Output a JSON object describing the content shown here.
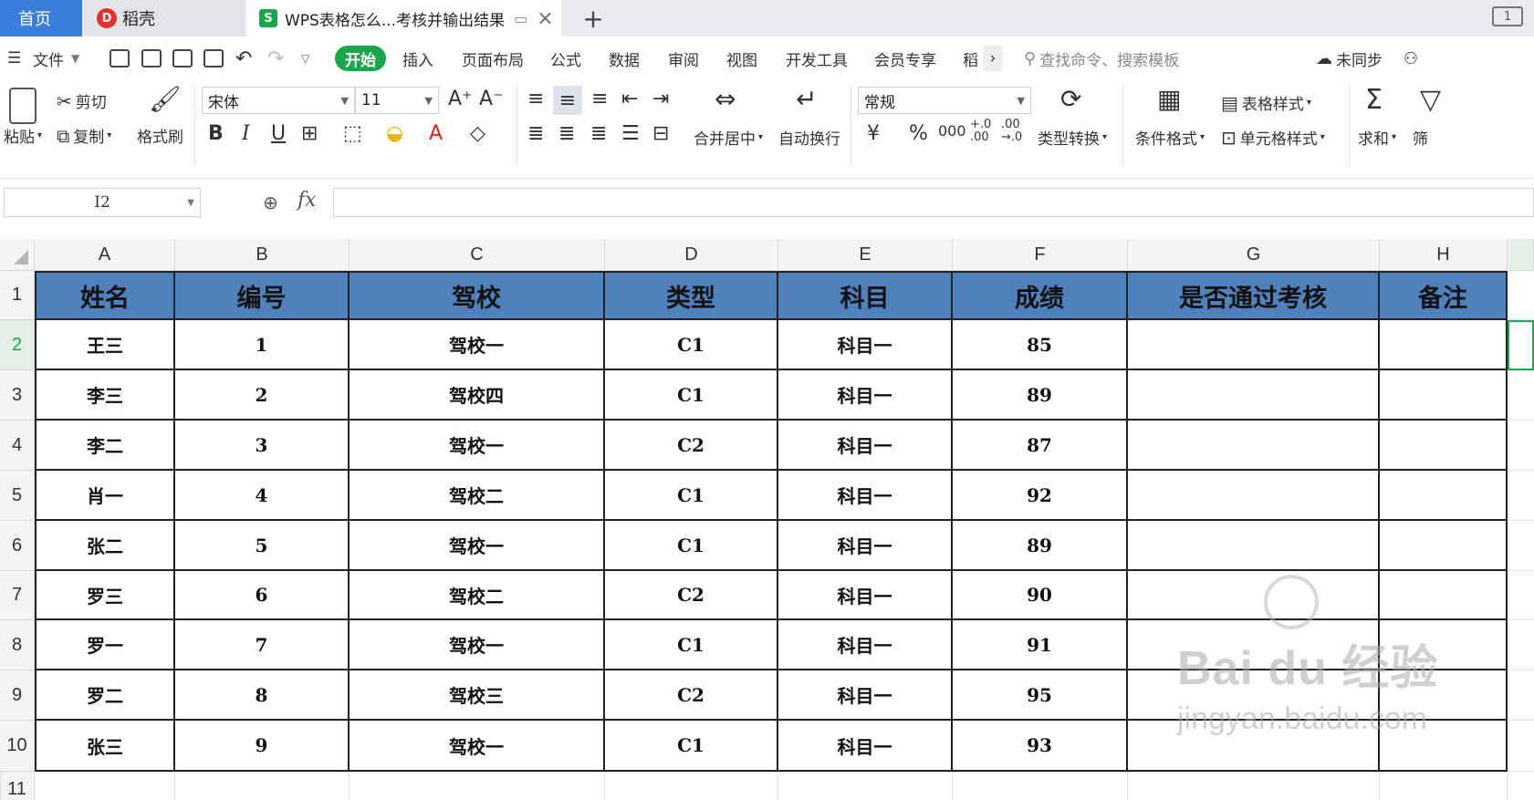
{
  "tabs": {
    "home": "首页",
    "docer": "稻壳",
    "doc_title": "WPS表格怎么...考核并输出结果",
    "new_tab": "+",
    "window_button": "1"
  },
  "menu": {
    "file": "文件",
    "items": [
      "开始",
      "插入",
      "页面布局",
      "公式",
      "数据",
      "审阅",
      "视图",
      "开发工具",
      "会员专享",
      "稻"
    ],
    "active": "开始",
    "more": "›",
    "search_placeholder": "查找命令、搜索模板",
    "sync": "未同步"
  },
  "ribbon": {
    "paste": "粘贴",
    "cut": "剪切",
    "copy": "复制",
    "format_painter": "格式刷",
    "font_name": "宋体",
    "font_size": "11",
    "bold": "B",
    "italic": "I",
    "underline": "U",
    "merge_center": "合并居中",
    "wrap_text": "自动换行",
    "number_format": "常规",
    "currency": "¥",
    "percent": "%",
    "thousands": "000",
    "inc_decimal": "+.0\n.00",
    "dec_decimal": ".00\n→.0",
    "type_convert": "类型转换",
    "conditional_format": "条件格式",
    "table_style": "表格样式",
    "cell_style": "单元格样式",
    "sum": "求和",
    "filter": "筛"
  },
  "formula_bar": {
    "name_box": "I2",
    "fx": "fx",
    "formula": ""
  },
  "sheet": {
    "columns": [
      "A",
      "B",
      "C",
      "D",
      "E",
      "F",
      "G",
      "H"
    ],
    "row_numbers": [
      "1",
      "2",
      "3",
      "4",
      "5",
      "6",
      "7",
      "8",
      "9",
      "10",
      "11"
    ],
    "selected_row": "2",
    "header": [
      "姓名",
      "编号",
      "驾校",
      "类型",
      "科目",
      "成绩",
      "是否通过考核",
      "备注"
    ],
    "header_color": "#4f81bd",
    "rows": [
      [
        "王三",
        "1",
        "驾校一",
        "C1",
        "科目一",
        "85",
        "",
        ""
      ],
      [
        "李三",
        "2",
        "驾校四",
        "C1",
        "科目一",
        "89",
        "",
        ""
      ],
      [
        "李二",
        "3",
        "驾校一",
        "C2",
        "科目一",
        "87",
        "",
        ""
      ],
      [
        "肖一",
        "4",
        "驾校二",
        "C1",
        "科目一",
        "92",
        "",
        ""
      ],
      [
        "张二",
        "5",
        "驾校一",
        "C1",
        "科目一",
        "89",
        "",
        ""
      ],
      [
        "罗三",
        "6",
        "驾校二",
        "C2",
        "科目一",
        "90",
        "",
        ""
      ],
      [
        "罗一",
        "7",
        "驾校一",
        "C1",
        "科目一",
        "91",
        "",
        ""
      ],
      [
        "罗二",
        "8",
        "驾校三",
        "C2",
        "科目一",
        "95",
        "",
        ""
      ],
      [
        "张三",
        "9",
        "驾校一",
        "C1",
        "科目一",
        "93",
        "",
        ""
      ]
    ]
  },
  "watermark": {
    "brand": "Bai du 经验",
    "url": "jingyan.baidu.com"
  },
  "colors": {
    "accent_green": "#1aa64b",
    "home_tab_blue": "#3b7ddb"
  }
}
